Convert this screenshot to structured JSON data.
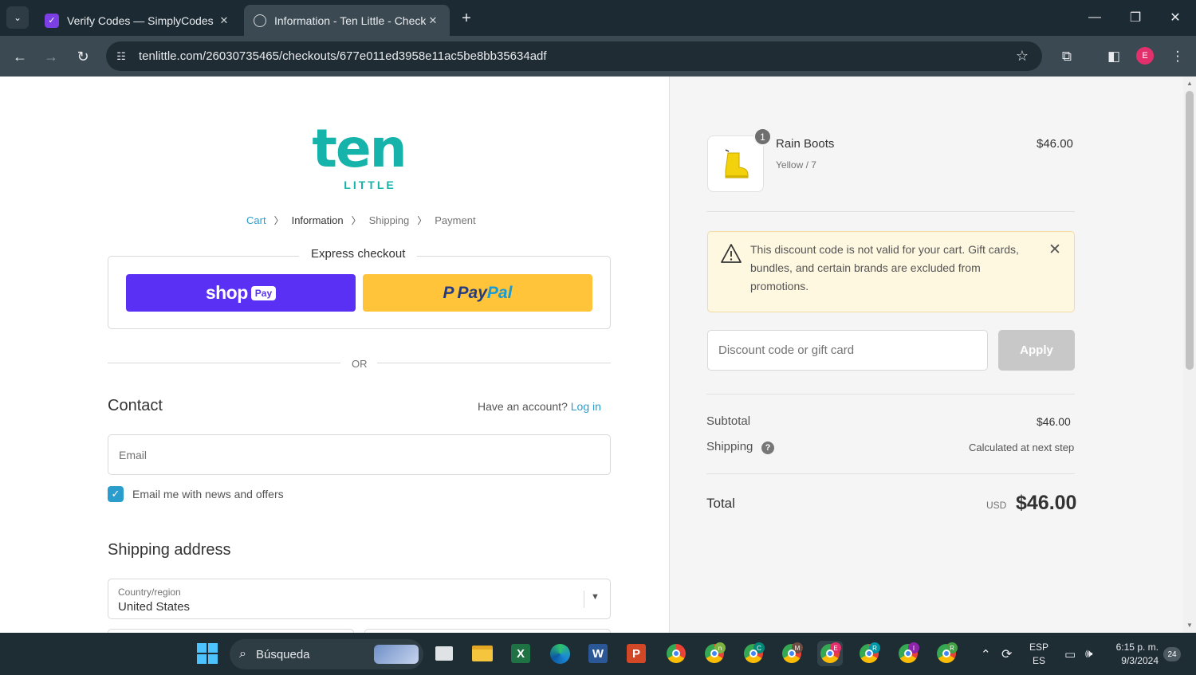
{
  "browser": {
    "tabs": [
      {
        "title": "Verify Codes — SimplyCodes",
        "active": false
      },
      {
        "title": "Information - Ten Little - Checkout",
        "active": true
      }
    ],
    "url": "tenlittle.com/26030735465/checkouts/677e011ed3958e11ac5be8bb35634adf",
    "profile_initial": "E"
  },
  "logo": {
    "big": "ten",
    "small": "LITTLE"
  },
  "breadcrumb": {
    "cart": "Cart",
    "information": "Information",
    "shipping": "Shipping",
    "payment": "Payment"
  },
  "express": {
    "title": "Express checkout",
    "shop_word": "shop",
    "shop_pay": "Pay",
    "paypal_a": "Pay",
    "paypal_b": "Pal"
  },
  "or_text": "OR",
  "contact": {
    "heading": "Contact",
    "account_text": "Have an account?",
    "login": "Log in",
    "email_placeholder": "Email",
    "newsletter_label": "Email me with news and offers",
    "newsletter_checked": true
  },
  "shipping": {
    "heading": "Shipping address",
    "country_label": "Country/region",
    "country_value": "United States"
  },
  "order": {
    "item": {
      "name": "Rain Boots",
      "variant": "Yellow / 7",
      "price": "$46.00",
      "quantity": "1"
    },
    "alert": "This discount code is not valid for your cart. Gift cards, bundles, and certain brands are excluded from promotions.",
    "discount_placeholder": "Discount code or gift card",
    "apply_label": "Apply",
    "subtotal_label": "Subtotal",
    "subtotal_value": "$46.00",
    "shipping_label": "Shipping",
    "shipping_value": "Calculated at next step",
    "total_label": "Total",
    "currency": "USD",
    "total_value": "$46.00"
  },
  "taskbar": {
    "search": "Búsqueda",
    "lang_top": "ESP",
    "lang_bottom": "ES",
    "time": "6:15 p. m.",
    "date": "9/3/2024",
    "notifications": "24",
    "chrome_badges": [
      "",
      "n",
      "C",
      "M",
      "E",
      "R",
      "I",
      "R"
    ]
  },
  "colors": {
    "accent": "#2a9dcc",
    "brand": "#16b3aa",
    "shop": "#5a31f4",
    "paypal": "#ffc439",
    "alert_bg": "#fff8e1"
  }
}
